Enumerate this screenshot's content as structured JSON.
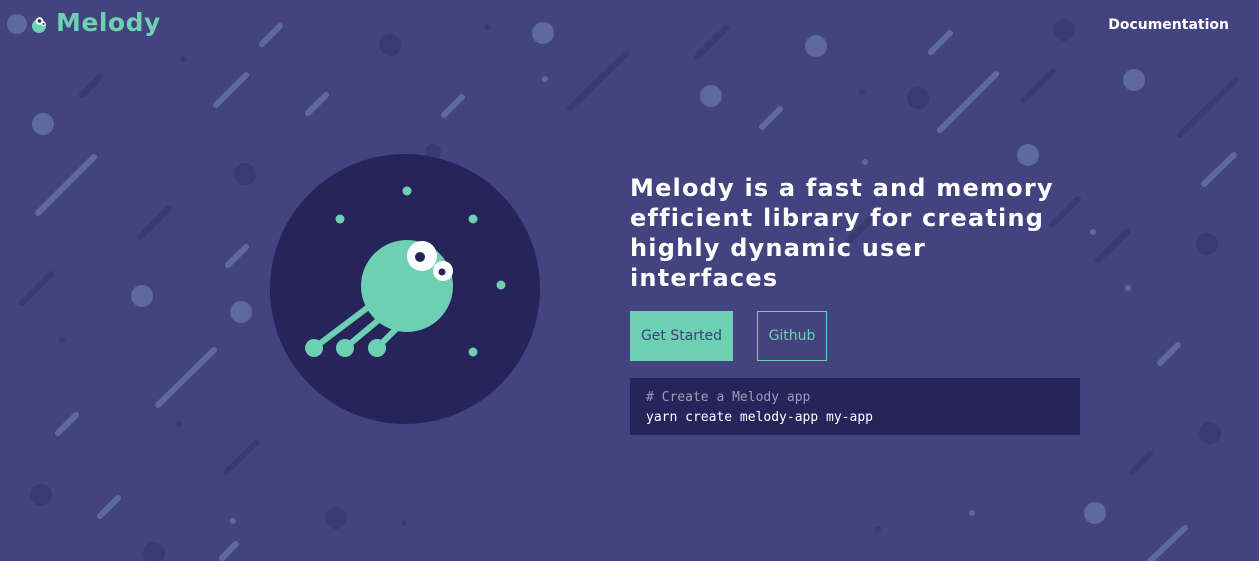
{
  "brand": {
    "name": "Melody",
    "logo_icon": "melody-creature-icon"
  },
  "nav": {
    "documentation_label": "Documentation"
  },
  "hero": {
    "title": "Melody is a fast and memory efficient library for creating highly dynamic user interfaces",
    "illustration_icon": "melody-creature-illustration"
  },
  "actions": {
    "get_started_label": "Get Started",
    "github_label": "Github"
  },
  "code": {
    "comment": "# Create a Melody app",
    "command": "yarn create melody-app my-app"
  },
  "colors": {
    "background": "#43437f",
    "accent": "#6dd0b2",
    "dark": "#26245a",
    "text": "#ffffff"
  }
}
